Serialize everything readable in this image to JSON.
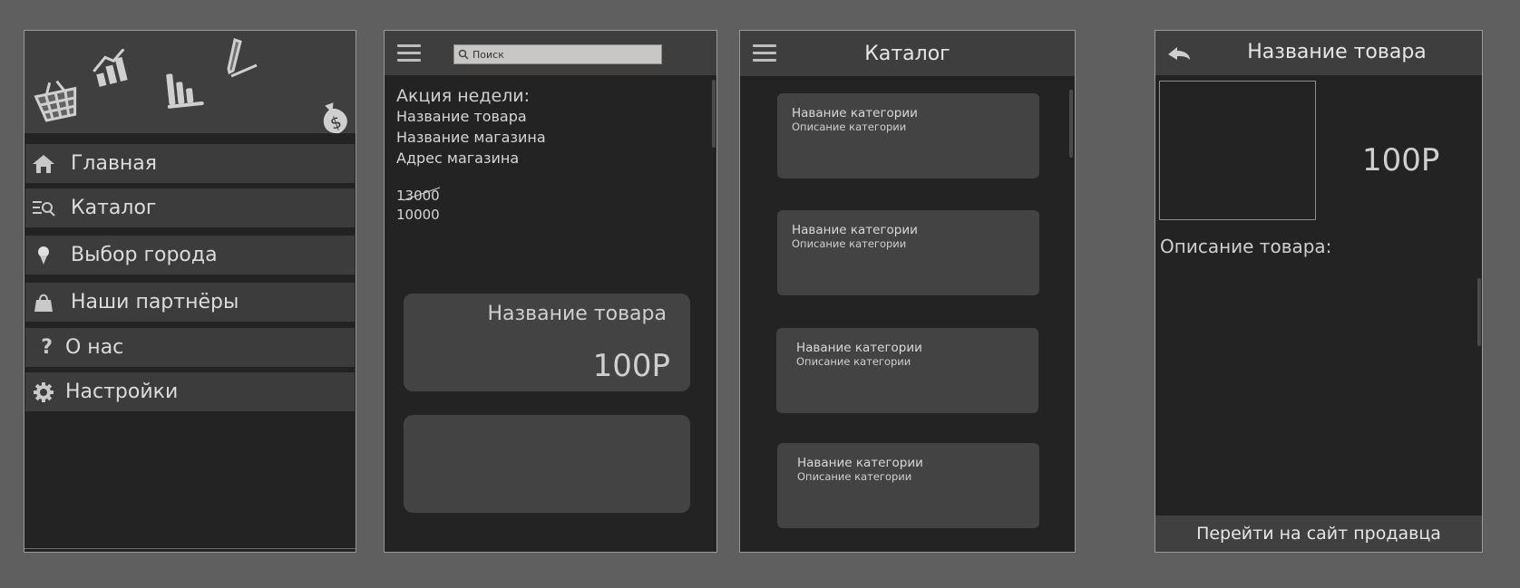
{
  "menu_screen": {
    "items": [
      {
        "label": "Главная",
        "icon": "home-icon"
      },
      {
        "label": "Каталог",
        "icon": "catalog-search-icon"
      },
      {
        "label": "Выбор города",
        "icon": "location-pin-icon"
      },
      {
        "label": "Наши партнёры",
        "icon": "shopping-bag-icon"
      },
      {
        "label": "О нас",
        "icon": "question-icon"
      },
      {
        "label": "Настройки",
        "icon": "gear-icon"
      }
    ]
  },
  "promo_screen": {
    "search_placeholder": "Поиск",
    "promo_title": "Акция недели:",
    "product_name": "Название товара",
    "shop_name": "Название магазина",
    "shop_address": "Адрес магазина",
    "old_price": "13000",
    "new_price": "10000",
    "card_title": "Название товара",
    "card_price": "100Р"
  },
  "catalog_screen": {
    "title": "Каталог",
    "categories": [
      {
        "name": "Навание категории",
        "description": "Описание категории"
      },
      {
        "name": "Навание категории",
        "description": "Описание категории"
      },
      {
        "name": "Навание категории",
        "description": "Описание категории"
      },
      {
        "name": "Навание категории",
        "description": "Описание категории"
      }
    ]
  },
  "product_screen": {
    "title": "Название товара",
    "price": "100Р",
    "description_label": "Описание товара:",
    "seller_button": "Перейти на сайт продавца"
  },
  "colors": {
    "page_bg": "#5f5f5f",
    "panel_bg": "#232323",
    "bar_bg": "#3e3e3e",
    "card_bg": "#434343",
    "text": "#d6d6d6"
  }
}
